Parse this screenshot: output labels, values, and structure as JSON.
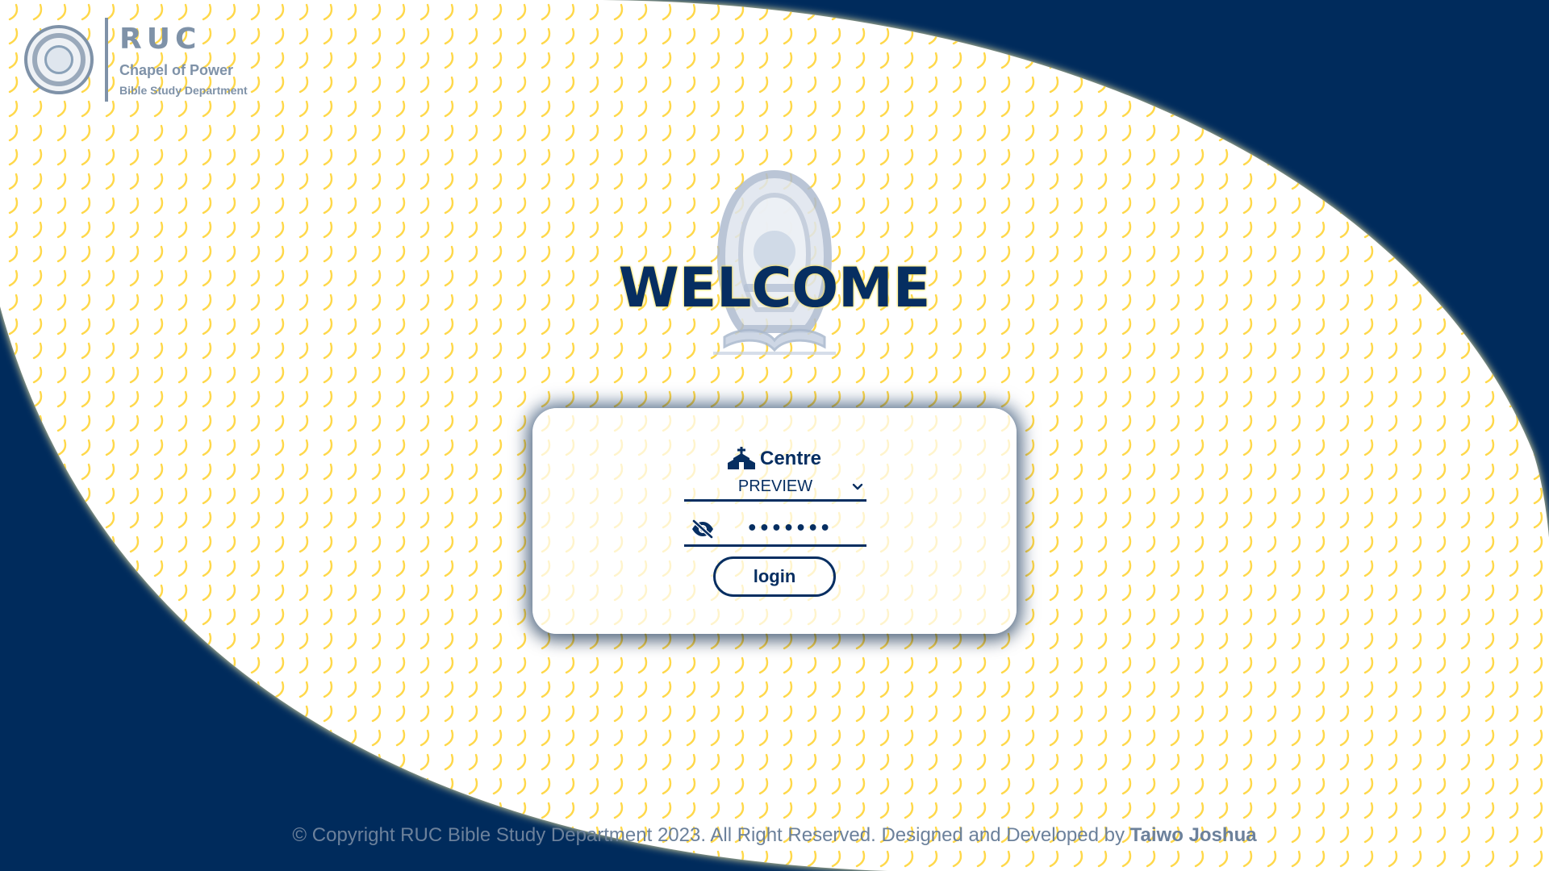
{
  "brand": {
    "abbrev": "RUC",
    "name": "Chapel of Power",
    "department": "Bible Study Department",
    "emblem_icon": "ruc-seal-icon"
  },
  "crest_icon": "bible-study-crest-icon",
  "welcome": "WELCOME",
  "login_card": {
    "centre_label": "Centre",
    "centre_icon": "church-icon",
    "centre_selected": "PREVIEW",
    "password_value": "•••••••",
    "toggle_icon": "eye-slash-icon",
    "login_label": "login"
  },
  "footer": {
    "text": "© Copyright RUC Bible Study Department 2023. All Right Reserved. Designed and Developed by ",
    "developer": "Taiwo Joshua"
  },
  "colors": {
    "navy": "#002b5c",
    "dark_navy_text": "#062e61",
    "accent_yellow": "#ffd84a",
    "muted_blue_gray": "#7f92a8"
  }
}
